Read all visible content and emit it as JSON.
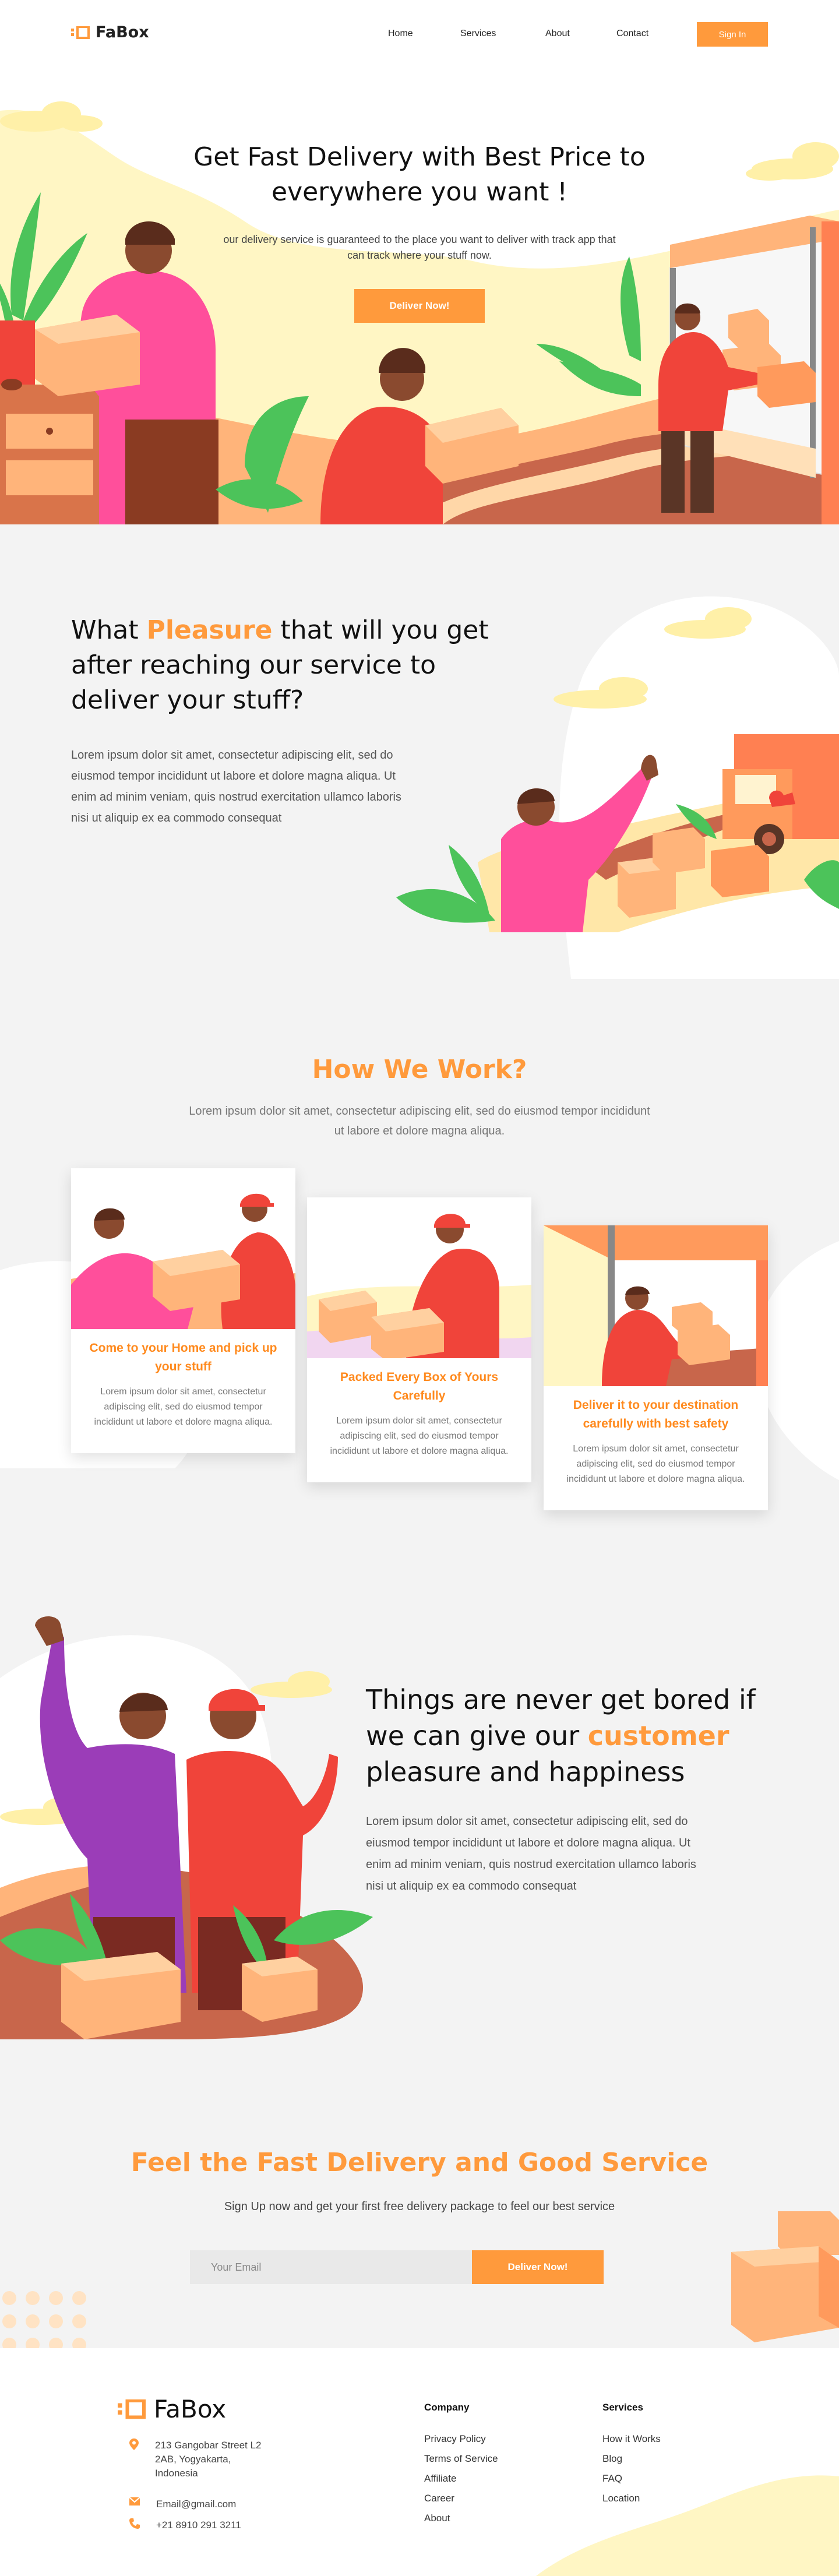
{
  "nav": {
    "brand": "FaBox",
    "links": [
      "Home",
      "Services",
      "About",
      "Contact"
    ],
    "signin_label": "Sign In"
  },
  "hero": {
    "title": "Get Fast Delivery with Best Price to everywhere you want !",
    "subtitle": "our delivery service is guaranteed to the place you want to deliver with track app that can track where your stuff now.",
    "cta_label": "Deliver Now!"
  },
  "pleasure": {
    "title_pre": "What ",
    "title_highlight": "Pleasure",
    "title_post": " that will you get after reaching our service to deliver your stuff?",
    "text": "Lorem ipsum dolor sit amet, consectetur adipiscing elit, sed do eiusmod tempor incididunt ut labore et dolore magna aliqua. Ut enim ad minim veniam, quis nostrud exercitation ullamco laboris nisi ut aliquip ex ea commodo consequat"
  },
  "how": {
    "title": "How We Work?",
    "subtitle": "Lorem ipsum dolor sit amet, consectetur adipiscing elit, sed do eiusmod tempor incididunt ut labore et dolore magna aliqua.",
    "cards": [
      {
        "title": "Come to your Home and pick up your stuff",
        "text": "Lorem ipsum dolor sit amet, consectetur adipiscing elit, sed do eiusmod tempor incididunt ut labore et dolore magna aliqua."
      },
      {
        "title": "Packed Every Box of Yours Carefully",
        "text": "Lorem ipsum dolor sit amet, consectetur adipiscing elit, sed do eiusmod tempor incididunt ut labore et dolore magna aliqua."
      },
      {
        "title": "Deliver it to your destination carefully with best safety",
        "text": "Lorem ipsum dolor sit amet, consectetur adipiscing elit, sed do eiusmod tempor incididunt ut labore et dolore magna aliqua."
      }
    ]
  },
  "happiness": {
    "title_pre": "Things are never get bored if we can give our ",
    "title_highlight": "customer",
    "title_post": " pleasure and happiness",
    "text": "Lorem ipsum dolor sit amet, consectetur adipiscing elit, sed do eiusmod tempor incididunt ut labore et dolore magna aliqua. Ut enim ad minim veniam, quis nostrud exercitation ullamco laboris nisi ut aliquip ex ea commodo consequat"
  },
  "signup": {
    "title": "Feel the Fast Delivery and Good Service",
    "subtitle": "Sign Up now and get your first free delivery package to feel our best service",
    "email_placeholder": "Your Email",
    "cta_label": "Deliver Now!"
  },
  "footer": {
    "brand": "FaBox",
    "address": "213 Gangobar Street L2 2AB, Yogyakarta, Indonesia",
    "email": "Email@gmail.com",
    "phone": "+21 8910 291 3211",
    "company_title": "Company",
    "company_links": [
      "Privacy Policy",
      "Terms of Service",
      "Affiliate",
      "Career",
      "About"
    ],
    "services_title": "Services",
    "services_links": [
      "How it Works",
      "Blog",
      "FAQ",
      "Location"
    ]
  },
  "colors": {
    "accent": "#ff9a3c",
    "pink": "#ff4f9b",
    "red": "#f0443a",
    "cream": "#fff6c4",
    "peach": "#ffb47a",
    "green": "#4cc35a",
    "background_grey": "#f3f3f3"
  },
  "icons": [
    "logo-mark-icon",
    "location-pin-icon",
    "mail-icon",
    "phone-icon"
  ]
}
